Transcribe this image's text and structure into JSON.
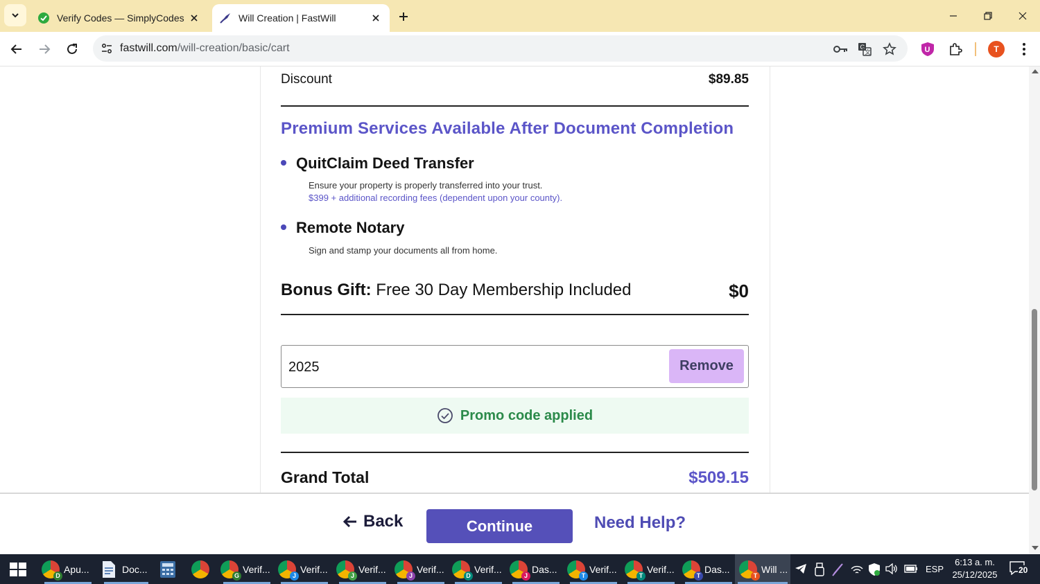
{
  "browser": {
    "tabs": [
      {
        "title": "Verify Codes — SimplyCodes",
        "active": false
      },
      {
        "title": "Will Creation | FastWill",
        "active": true
      }
    ],
    "url_host": "fastwill.com",
    "url_path": "/will-creation/basic/cart",
    "profile_initial": "T"
  },
  "cart": {
    "discount_label": "Discount",
    "discount_amount": "$89.85",
    "premium_heading": "Premium Services Available After Document Completion",
    "services": [
      {
        "name": "QuitClaim Deed Transfer",
        "description": "Ensure your property is properly transferred into your trust.",
        "price_note": "$399 + additional recording fees (dependent upon your county)."
      },
      {
        "name": "Remote Notary",
        "description": "Sign and stamp your documents all from home."
      }
    ],
    "bonus_label_bold": "Bonus Gift:",
    "bonus_label_rest": " Free 30 Day Membership Included",
    "bonus_amount": "$0",
    "promo_code": "2025",
    "remove_label": "Remove",
    "promo_status": "Promo code applied",
    "grand_total_label": "Grand Total",
    "grand_total_amount": "$509.15"
  },
  "footer": {
    "back_label": "Back",
    "continue_label": "Continue",
    "help_label": "Need Help?"
  },
  "taskbar": {
    "items": [
      {
        "label": "Apu...",
        "badge": "D",
        "badge_color": "#2f7d32"
      },
      {
        "label": "Doc..."
      },
      {
        "label": "Verif...",
        "badge": "G",
        "badge_color": "#2f7d32"
      },
      {
        "label": "Verif...",
        "badge": "J",
        "badge_color": "#1e88e5"
      },
      {
        "label": "Verif...",
        "badge": "J",
        "badge_color": "#43a047"
      },
      {
        "label": "Verif...",
        "badge": "J",
        "badge_color": "#8e44ad"
      },
      {
        "label": "Verif...",
        "badge": "D",
        "badge_color": "#00897b"
      },
      {
        "label": "Das...",
        "badge": "J",
        "badge_color": "#d81b60"
      },
      {
        "label": "Verif...",
        "badge": "T",
        "badge_color": "#1e88e5"
      },
      {
        "label": "Verif...",
        "badge": "T",
        "badge_color": "#00897b"
      },
      {
        "label": "Das...",
        "badge": "T",
        "badge_color": "#3949ab"
      },
      {
        "label": "Will ...",
        "badge": "T",
        "badge_color": "#e8521f"
      }
    ],
    "language": "ESP",
    "time": "6:13 a. m.",
    "date": "25/12/2025",
    "notification_count": "20"
  },
  "colors": {
    "accent": "#5550b9",
    "heading_purple": "#5b55c8",
    "success_green": "#2b8a4a",
    "remove_button": "#dab6f7",
    "tab_strip": "#f6e7b3"
  }
}
